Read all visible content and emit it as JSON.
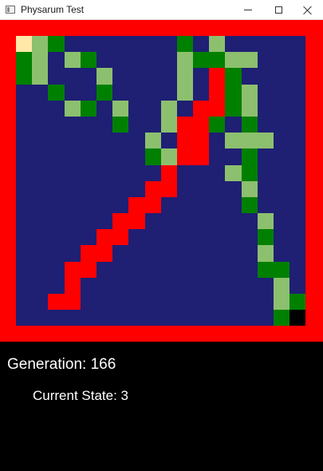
{
  "window": {
    "title": "Physarum Test",
    "icon": "app-window-icon",
    "controls": {
      "minimize_icon": "minimize-icon",
      "maximize_icon": "maximize-icon",
      "close_icon": "close-icon"
    }
  },
  "colors": {
    "border": "#ff0000",
    "background": "#1f1f74",
    "info_background": "#000000",
    "text": "#ffffff"
  },
  "grid": {
    "columns": 18,
    "rows": 18,
    "legend": {
      ".": "#1f1f74",
      "R": "#ff0000",
      "G": "#008000",
      "L": "#8cc06e",
      "Y": "#ffe8a8",
      "K": "#000000"
    },
    "cells": [
      "YLG.......G.L.....",
      "GL.LG.....LGGLL...",
      "GL...L....L.RG....",
      "..G..G....L.RGL...",
      "...LG.L..L.RRGL...",
      "......G..LRRG.G...",
      "........L.RR.LLL..",
      "........GLRR..G...",
      ".........R...LG...",
      "........RR....L...",
      ".......RR.....G...",
      "......RR.......L..",
      ".....RR........G..",
      "....RR.........L..",
      "...RR..........GG.",
      "...R............L.",
      "..RR............LG",
      "................GK"
    ]
  },
  "status": {
    "generation": "Generation: 166",
    "current_state": "Current State: 3"
  }
}
